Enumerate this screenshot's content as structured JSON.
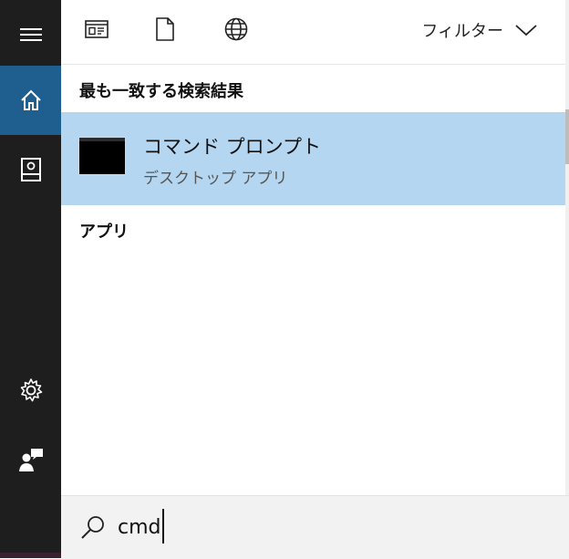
{
  "colors": {
    "rail_bg": "#1e1e1e",
    "rail_active": "#1f5f8f",
    "result_highlight": "#b5d6f0",
    "search_bg": "#f2f2f2"
  },
  "sidebar": {
    "items": [
      {
        "icon": "hamburger-menu-icon"
      },
      {
        "icon": "home-icon",
        "active": true
      },
      {
        "icon": "notebook-icon"
      },
      {
        "icon": "settings-gear-icon"
      },
      {
        "icon": "feedback-person-icon"
      }
    ]
  },
  "topbar": {
    "icons": [
      "apps-window-icon",
      "document-icon",
      "globe-icon"
    ],
    "filter_label": "フィルター",
    "filter_icon": "chevron-down-icon"
  },
  "best_match": {
    "title": "最も一致する検索結果",
    "result": {
      "name": "コマンド プロンプト",
      "type": "デスクトップ アプリ",
      "icon": "command-prompt-thumbnail"
    }
  },
  "apps_section": {
    "title": "アプリ"
  },
  "search": {
    "icon": "search-icon",
    "value": "cmd"
  }
}
